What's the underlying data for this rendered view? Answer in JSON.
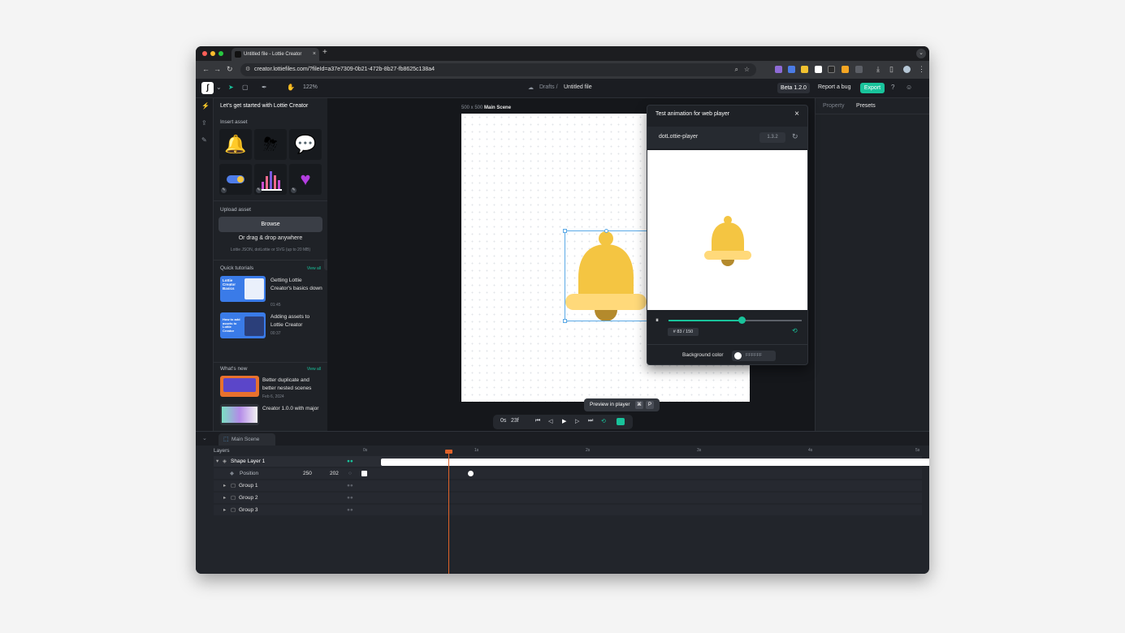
{
  "browser": {
    "tab_title": "Untitled file - Lottie Creator",
    "new_tab": "+",
    "close_tab": "×",
    "url": "creator.lottiefiles.com/?fileId=a37e7309-0b21-472b-8b27-fb8625c138a4",
    "traffic_lights": [
      "#ff5f57",
      "#febc2e",
      "#28c840"
    ]
  },
  "toolbar": {
    "zoom": "122%",
    "breadcrumb_parent": "Drafts /",
    "file_name": "Untitled file",
    "beta": "Beta 1.2.0",
    "report_bug": "Report a bug",
    "export": "Export",
    "accent_color": "#19c39b"
  },
  "left_panel": {
    "title": "Let's get started with Lottie Creator",
    "insert_asset": "Insert asset",
    "upload_asset": "Upload asset",
    "browse": "Browse",
    "drag_drop": "Or drag & drop anywhere",
    "formats": "Lottie JSON, dotLottie or SVG (up to 20 MB)",
    "quick_tutorials": "Quick tutorials",
    "view_all": "View all",
    "tutorials": [
      {
        "title": "Getting Lottie Creator's basics down",
        "duration": "01:45",
        "thumb_text": "Lottie Creator Basics"
      },
      {
        "title": "Adding assets to Lottie Creator",
        "duration": "00:37",
        "thumb_text": "How to add assets to Lottie Creator"
      }
    ],
    "whats_new": "What's new",
    "news": [
      {
        "title": "Better duplicate and better nested scenes",
        "date": "Feb 6, 2024"
      },
      {
        "title": "Creator 1.0.0 with major",
        "date": ""
      }
    ]
  },
  "stage": {
    "size_label": "500 x 500",
    "scene_name": "Main Scene",
    "time": "0s",
    "frame": "23f",
    "tooltip": "Preview in player",
    "tooltip_keys": [
      "⌘",
      "P"
    ]
  },
  "player_popup": {
    "title": "Test animation for web player",
    "player_name": "dotLottie-player",
    "version": "1.3.2",
    "frame_counter": "# 83 / 150",
    "progress": 0.55,
    "bg_label": "Background color",
    "bg_value": "FFFFFF"
  },
  "right_panel": {
    "tabs": [
      "Property",
      "Presets"
    ]
  },
  "timeline": {
    "tab": "Main Scene",
    "layers_label": "Layers",
    "ruler": [
      "0s",
      "1s",
      "2s",
      "3s",
      "4s",
      "5s"
    ],
    "layer": "Shape Layer 1",
    "position_label": "Position",
    "position_x": "250",
    "position_y": "202",
    "groups": [
      "Group 1",
      "Group 2",
      "Group 3"
    ]
  }
}
